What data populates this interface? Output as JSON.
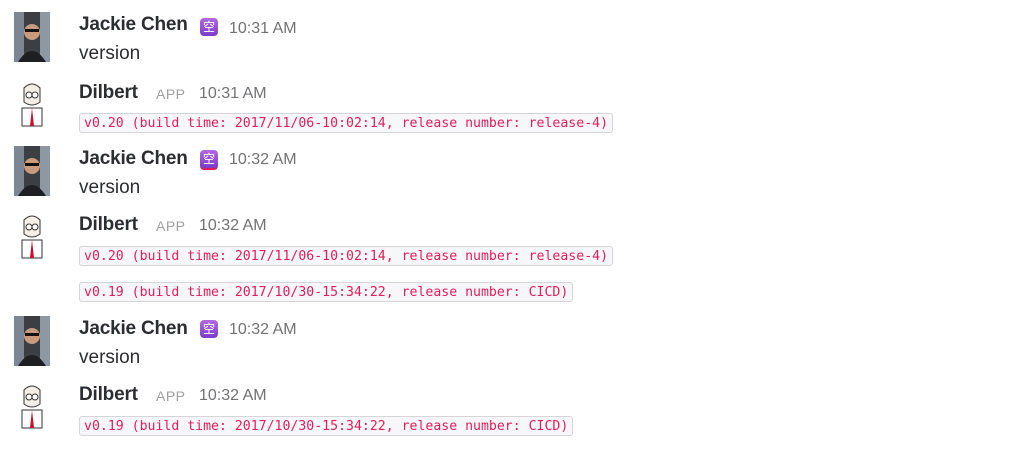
{
  "messages": [
    {
      "sender": "Jackie Chen",
      "emoji": "空",
      "time": "10:31 AM",
      "text": "version"
    },
    {
      "sender": "Dilbert",
      "badge": "APP",
      "time": "10:31 AM",
      "code": [
        "v0.20 (build time: 2017/11/06-10:02:14, release number: release-4)"
      ]
    },
    {
      "sender": "Jackie Chen",
      "emoji": "空",
      "time": "10:32 AM",
      "text": "version"
    },
    {
      "sender": "Dilbert",
      "badge": "APP",
      "time": "10:32 AM",
      "code": [
        "v0.20 (build time: 2017/11/06-10:02:14, release number: release-4)",
        "v0.19 (build time: 2017/10/30-15:34:22, release number: CICD)"
      ]
    },
    {
      "sender": "Jackie Chen",
      "emoji": "空",
      "time": "10:32 AM",
      "text": "version"
    },
    {
      "sender": "Dilbert",
      "badge": "APP",
      "time": "10:32 AM",
      "code": [
        "v0.19 (build time: 2017/10/30-15:34:22, release number: CICD)"
      ]
    }
  ],
  "colors": {
    "code_text": "#e01e5a",
    "emoji_bg": "#9b51e0"
  }
}
